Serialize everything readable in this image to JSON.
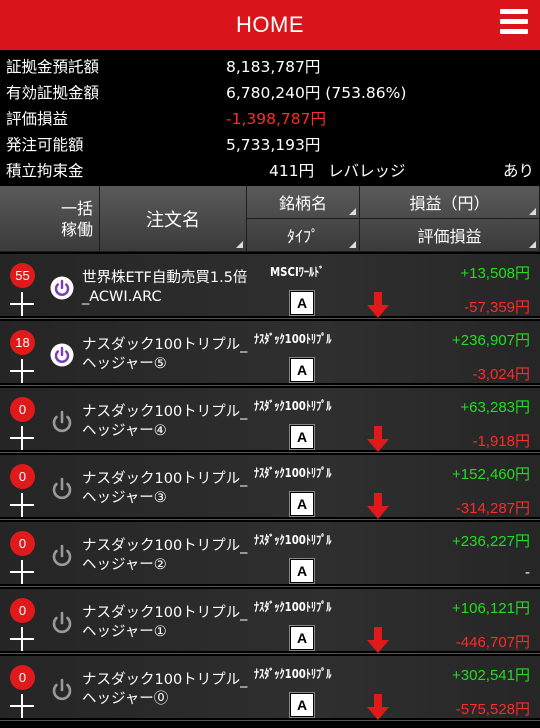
{
  "header": {
    "title": "HOME",
    "menu_icon": "hamburger-menu-icon"
  },
  "summary": {
    "margin_deposit": {
      "label": "証拠金預託額",
      "value": "8,183,787円"
    },
    "effective_margin": {
      "label": "有効証拠金額",
      "value": "6,780,240円 (753.86%)"
    },
    "valuation_pl": {
      "label": "評価損益",
      "value": "-1,398,787円"
    },
    "orderable": {
      "label": "発注可能額",
      "value": "5,733,193円"
    },
    "reserve": {
      "label": "積立拘束金",
      "value": "411円"
    },
    "leverage": {
      "label": "レバレッジ",
      "value": "あり"
    }
  },
  "columns": {
    "bulk": "一括\n稼働",
    "order_name": "注文名",
    "stock_name": "銘柄名",
    "type": "ﾀｲﾌﾟ",
    "pl": "損益（円）",
    "valuation": "評価損益"
  },
  "colors": {
    "accent": "#d9141b",
    "positive": "#22dd22",
    "negative": "#ff2a2a"
  },
  "rows": [
    {
      "count": "55",
      "active": true,
      "name": "世界株ETF自動売買1.5倍_ACWI.ARC",
      "stock": "MSCIﾜｰﾙﾄﾞ",
      "type": "A",
      "arrow": true,
      "pl": "+13,508円",
      "valuation": "-57,359円"
    },
    {
      "count": "18",
      "active": true,
      "name": "ナスダック100トリプル_ヘッジャー⑤",
      "stock": "ﾅｽﾀﾞｯｸ100ﾄﾘﾌﾟﾙ",
      "type": "A",
      "arrow": false,
      "pl": "+236,907円",
      "valuation": "-3,024円"
    },
    {
      "count": "0",
      "active": false,
      "name": "ナスダック100トリプル_ヘッジャー④",
      "stock": "ﾅｽﾀﾞｯｸ100ﾄﾘﾌﾟﾙ",
      "type": "A",
      "arrow": true,
      "pl": "+63,283円",
      "valuation": "-1,918円"
    },
    {
      "count": "0",
      "active": false,
      "name": "ナスダック100トリプル_ヘッジャー③",
      "stock": "ﾅｽﾀﾞｯｸ100ﾄﾘﾌﾟﾙ",
      "type": "A",
      "arrow": true,
      "pl": "+152,460円",
      "valuation": "-314,287円"
    },
    {
      "count": "0",
      "active": false,
      "name": "ナスダック100トリプル_ヘッジャー②",
      "stock": "ﾅｽﾀﾞｯｸ100ﾄﾘﾌﾟﾙ",
      "type": "A",
      "arrow": false,
      "pl": "+236,227円",
      "valuation": "-"
    },
    {
      "count": "0",
      "active": false,
      "name": "ナスダック100トリプル_ヘッジャー①",
      "stock": "ﾅｽﾀﾞｯｸ100ﾄﾘﾌﾟﾙ",
      "type": "A",
      "arrow": true,
      "pl": "+106,121円",
      "valuation": "-446,707円"
    },
    {
      "count": "0",
      "active": false,
      "name": "ナスダック100トリプル_ヘッジャー⓪",
      "stock": "ﾅｽﾀﾞｯｸ100ﾄﾘﾌﾟﾙ",
      "type": "A",
      "arrow": true,
      "pl": "+302,541円",
      "valuation": "-575,528円"
    }
  ]
}
